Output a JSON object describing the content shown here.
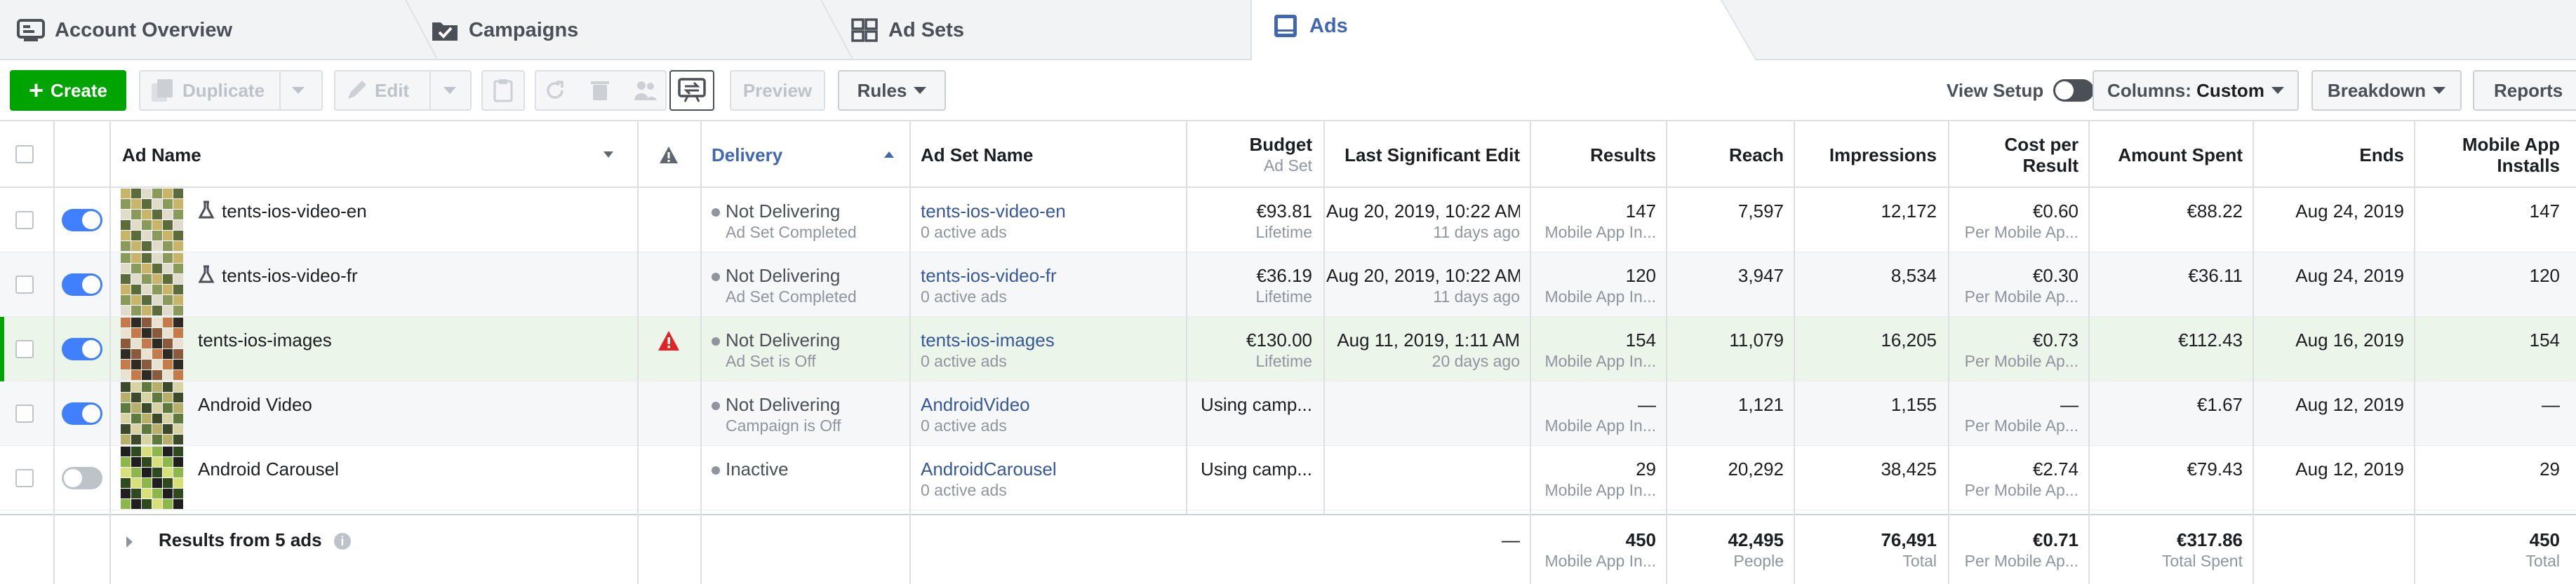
{
  "tabs": [
    {
      "label": "Account Overview",
      "icon": "account-overview-icon"
    },
    {
      "label": "Campaigns",
      "icon": "folder-check-icon"
    },
    {
      "label": "Ad Sets",
      "icon": "grid-icon"
    },
    {
      "label": "Ads",
      "icon": "ad-page-icon",
      "active": true
    }
  ],
  "toolbar": {
    "create": "Create",
    "duplicate": "Duplicate",
    "edit": "Edit",
    "preview": "Preview",
    "rules": "Rules",
    "view_setup": "View Setup",
    "columns_prefix": "Columns: ",
    "columns_value": "Custom",
    "breakdown": "Breakdown",
    "reports": "Reports"
  },
  "headers": {
    "ad_name": "Ad Name",
    "delivery": "Delivery",
    "ad_set_name": "Ad Set Name",
    "budget": "Budget",
    "budget_sub": "Ad Set",
    "last_edit": "Last Significant Edit",
    "results": "Results",
    "reach": "Reach",
    "impressions": "Impressions",
    "cost_per_result_1": "Cost per",
    "cost_per_result_2": "Result",
    "amount_spent": "Amount Spent",
    "ends": "Ends",
    "installs_1": "Mobile App",
    "installs_2": "Installs"
  },
  "rows": [
    {
      "name": "tents-ios-video-en",
      "flask": true,
      "on": true,
      "warn": false,
      "delivery": "Not Delivering",
      "delivery_sub": "Ad Set Completed",
      "adset": "tents-ios-video-en",
      "adset_sub": "0 active ads",
      "budget": "€93.81",
      "budget_sub": "Lifetime",
      "edit": "Aug 20, 2019, 10:22 AM",
      "edit_sub": "11 days ago",
      "results": "147",
      "results_sub": "Mobile App In...",
      "reach": "7,597",
      "impressions": "12,172",
      "cpr": "€0.60",
      "cpr_sub": "Per Mobile Ap...",
      "spent": "€88.22",
      "ends": "Aug 24, 2019",
      "installs": "147"
    },
    {
      "name": "tents-ios-video-fr",
      "flask": true,
      "on": true,
      "warn": false,
      "delivery": "Not Delivering",
      "delivery_sub": "Ad Set Completed",
      "adset": "tents-ios-video-fr",
      "adset_sub": "0 active ads",
      "budget": "€36.19",
      "budget_sub": "Lifetime",
      "edit": "Aug 20, 2019, 10:22 AM",
      "edit_sub": "11 days ago",
      "results": "120",
      "results_sub": "Mobile App In...",
      "reach": "3,947",
      "impressions": "8,534",
      "cpr": "€0.30",
      "cpr_sub": "Per Mobile Ap...",
      "spent": "€36.11",
      "ends": "Aug 24, 2019",
      "installs": "120"
    },
    {
      "name": "tents-ios-images",
      "flask": false,
      "on": true,
      "warn": true,
      "delivery": "Not Delivering",
      "delivery_sub": "Ad Set is Off",
      "adset": "tents-ios-images",
      "adset_sub": "0 active ads",
      "budget": "€130.00",
      "budget_sub": "Lifetime",
      "edit": "Aug 11, 2019, 1:11 AM",
      "edit_sub": "20 days ago",
      "results": "154",
      "results_sub": "Mobile App In...",
      "reach": "11,079",
      "impressions": "16,205",
      "cpr": "€0.73",
      "cpr_sub": "Per Mobile Ap...",
      "spent": "€112.43",
      "ends": "Aug 16, 2019",
      "installs": "154"
    },
    {
      "name": "Android Video",
      "flask": false,
      "on": true,
      "warn": false,
      "delivery": "Not Delivering",
      "delivery_sub": "Campaign is Off",
      "adset": "AndroidVideo",
      "adset_sub": "0 active ads",
      "budget": "Using camp...",
      "budget_sub": "",
      "edit": "",
      "edit_sub": "",
      "results": "—",
      "results_sub": "Mobile App In...",
      "reach": "1,121",
      "impressions": "1,155",
      "cpr": "—",
      "cpr_sub": "Per Mobile Ap...",
      "spent": "€1.67",
      "ends": "Aug 12, 2019",
      "installs": "—"
    },
    {
      "name": "Android Carousel",
      "flask": false,
      "on": false,
      "warn": false,
      "delivery": "Inactive",
      "delivery_sub": "",
      "adset": "AndroidCarousel",
      "adset_sub": "0 active ads",
      "budget": "Using camp...",
      "budget_sub": "",
      "edit": "",
      "edit_sub": "",
      "results": "29",
      "results_sub": "Mobile App In...",
      "reach": "20,292",
      "impressions": "38,425",
      "cpr": "€2.74",
      "cpr_sub": "Per Mobile Ap...",
      "spent": "€79.43",
      "ends": "Aug 12, 2019",
      "installs": "29"
    }
  ],
  "footer": {
    "label": "Results from 5 ads",
    "last_edit": "—",
    "results": "450",
    "results_sub": "Mobile App In...",
    "reach": "42,495",
    "reach_sub": "People",
    "impressions": "76,491",
    "impressions_sub": "Total",
    "cpr": "€0.71",
    "cpr_sub": "Per Mobile Ap...",
    "spent": "€317.86",
    "spent_sub": "Total Spent",
    "installs": "450",
    "installs_sub": "Total"
  },
  "colors": {
    "accent": "#4267b2",
    "create": "#00a400",
    "toggle_on": "#4080ff",
    "warning": "#e02424"
  }
}
